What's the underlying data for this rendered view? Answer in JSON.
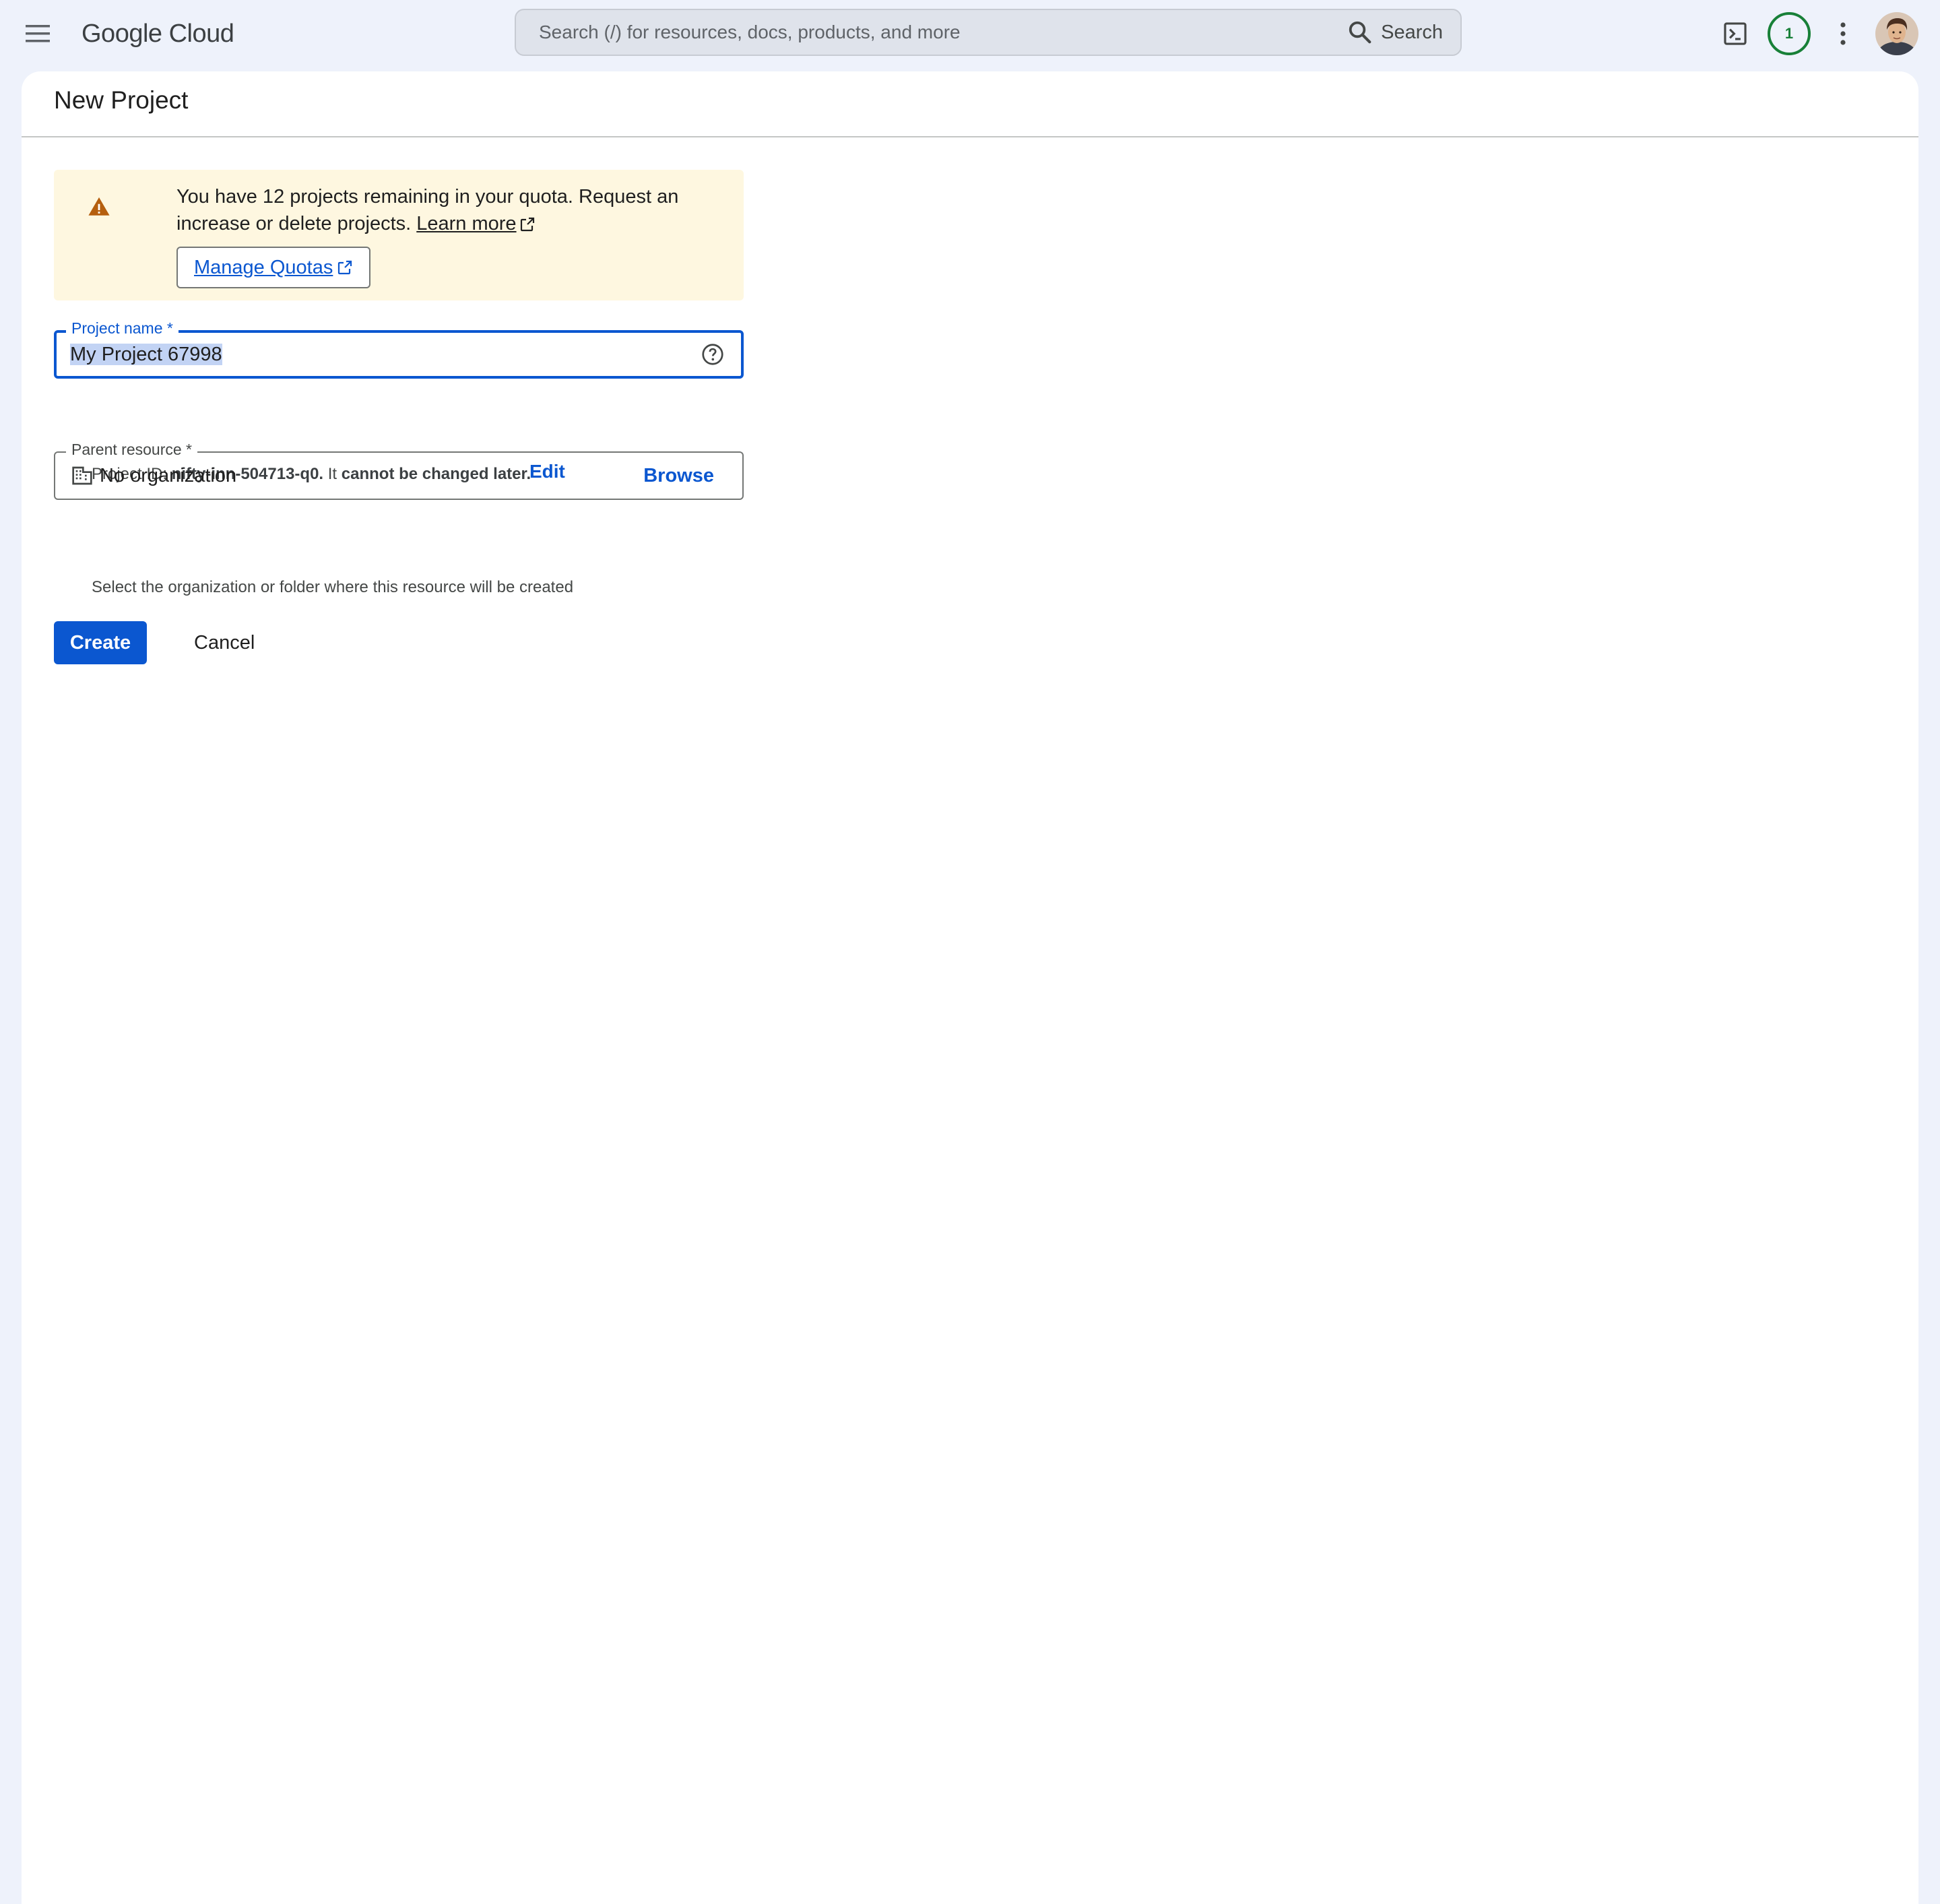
{
  "header": {
    "logo": "Google Cloud",
    "search": {
      "placeholder": "Search (/) for resources, docs, products, and more",
      "button_label": "Search"
    },
    "notification_count": "1"
  },
  "page": {
    "title": "New Project"
  },
  "quota_notice": {
    "message": "You have 12 projects remaining in your quota. Request an increase or delete projects.",
    "learn_more": "Learn more",
    "manage_quotas": "Manage Quotas"
  },
  "project_name_field": {
    "label": "Project name *",
    "value": "My Project 67998"
  },
  "project_id": {
    "prefix": "Project ID:",
    "id": "nifty-inn-504713-q0.",
    "middle": "It",
    "suffix": "cannot be changed later.",
    "edit_label": "Edit"
  },
  "parent_resource_field": {
    "label": "Parent resource *",
    "value": "No organization",
    "browse_label": "Browse",
    "hint": "Select the organization or folder where this resource will be created"
  },
  "actions": {
    "create_label": "Create",
    "cancel_label": "Cancel"
  },
  "colors": {
    "primary": "#0b57d0",
    "warning": "#b55f0e",
    "success": "#188038",
    "notice_background": "#fef7e0",
    "page_background": "#eef2fb"
  },
  "icons": {
    "menu": "hamburger-menu-icon",
    "search": "search-icon",
    "cloud_shell": "terminal-icon",
    "more": "more-vert-icon",
    "warning": "warning-icon",
    "external": "external-link-icon",
    "help": "help-icon",
    "organization": "building-icon"
  }
}
